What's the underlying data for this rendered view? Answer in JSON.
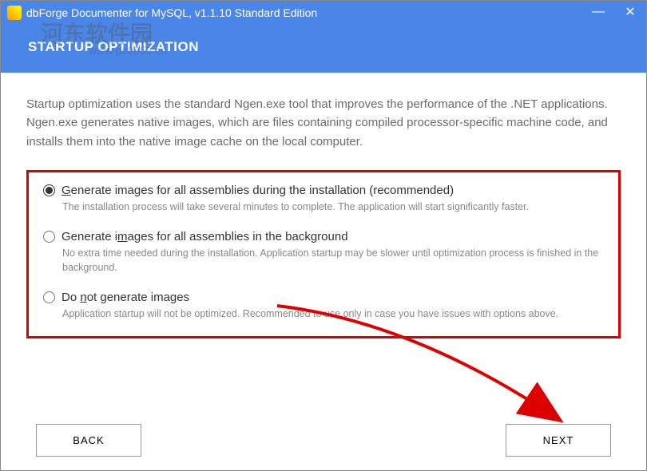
{
  "window": {
    "title": "dbForge Documenter for MySQL, v1.1.10 Standard Edition"
  },
  "watermark": {
    "line1": "河东软件园",
    "line2": "www.pc0359.cn"
  },
  "section_title": "STARTUP OPTIMIZATION",
  "intro": "Startup optimization uses the standard Ngen.exe tool that improves the performance of the .NET applications. Ngen.exe generates native images, which are files containing compiled processor-specific machine code, and installs them into the native image cache on the local computer.",
  "options": [
    {
      "label_pre": "G",
      "label_rest": "enerate images for all assemblies during the installation (recommended)",
      "desc": "The installation process will take several minutes to complete. The application will start significantly faster.",
      "checked": true
    },
    {
      "label_pre": "Generate i",
      "label_underline": "m",
      "label_rest": "ages for all assemblies in the background",
      "desc": "No extra time needed during the installation. Application startup may be slower until optimization process is finished in the background.",
      "checked": false
    },
    {
      "label_pre": "Do ",
      "label_underline": "n",
      "label_rest": "ot generate images",
      "desc": "Application startup will not be optimized. Recommended to use only in case you have issues with options above.",
      "checked": false
    }
  ],
  "buttons": {
    "back": "BACK",
    "next": "NEXT"
  }
}
